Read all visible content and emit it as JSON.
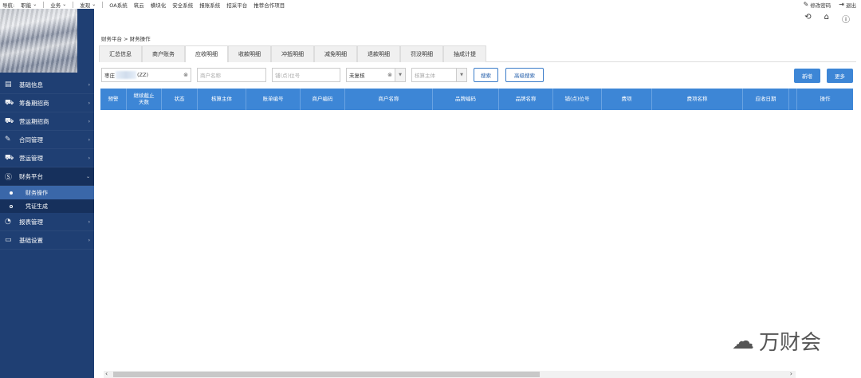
{
  "topnav": {
    "label": "导航:",
    "menus": [
      "职能",
      "业务",
      "发现"
    ],
    "links": [
      "OA系统",
      "筑云",
      "横块化",
      "安全系统",
      "报账系统",
      "招采平台",
      "推荐合作项目"
    ],
    "change_password": "修改密码",
    "logout": "退出"
  },
  "sidebar": {
    "items": [
      {
        "label": "基础信息",
        "icon": "doc-icon"
      },
      {
        "label": "筹备期招商",
        "icon": "cart-icon"
      },
      {
        "label": "营运期招商",
        "icon": "cart-icon"
      },
      {
        "label": "合同管理",
        "icon": "contract-icon"
      },
      {
        "label": "营运管理",
        "icon": "cart-icon"
      },
      {
        "label": "财务平台",
        "icon": "money-icon"
      }
    ],
    "sub_items": [
      "财务操作",
      "凭证生成"
    ],
    "items_after": [
      {
        "label": "报表管理",
        "icon": "pie-icon"
      },
      {
        "label": "基础设置",
        "icon": "folder-icon"
      }
    ]
  },
  "breadcrumb": "财务平台 > 财务操作",
  "tabs": [
    "汇总信息",
    "商户账务",
    "应收明细",
    "收款明细",
    "冲抵明细",
    "减免明细",
    "退款明细",
    "罚没明细",
    "抽成计提"
  ],
  "active_tab": "应收明细",
  "filters": {
    "project_value_prefix": "枣庄",
    "project_value_suffix": "(ZZ)",
    "merchant_placeholder": "商户名称",
    "shop_placeholder": "铺(点)位号",
    "status_value": "未复核",
    "entity_placeholder": "核算主体",
    "search_label": "搜索",
    "advanced_search_label": "高级搜索",
    "add_label": "新增",
    "more_label": "更多"
  },
  "table": {
    "columns": [
      "预警",
      "继续截止\n天数",
      "状态",
      "核算主体",
      "账单编号",
      "商户编码",
      "商户名称",
      "品牌编码",
      "品牌名称",
      "铺(点)位号",
      "费项",
      "费项名称",
      "应收日期",
      "",
      "操作"
    ]
  },
  "watermark": "万财会",
  "colors": {
    "sidebar": "#1f3f73",
    "accent": "#3d86d6",
    "active_sub": "#3a67a9"
  }
}
